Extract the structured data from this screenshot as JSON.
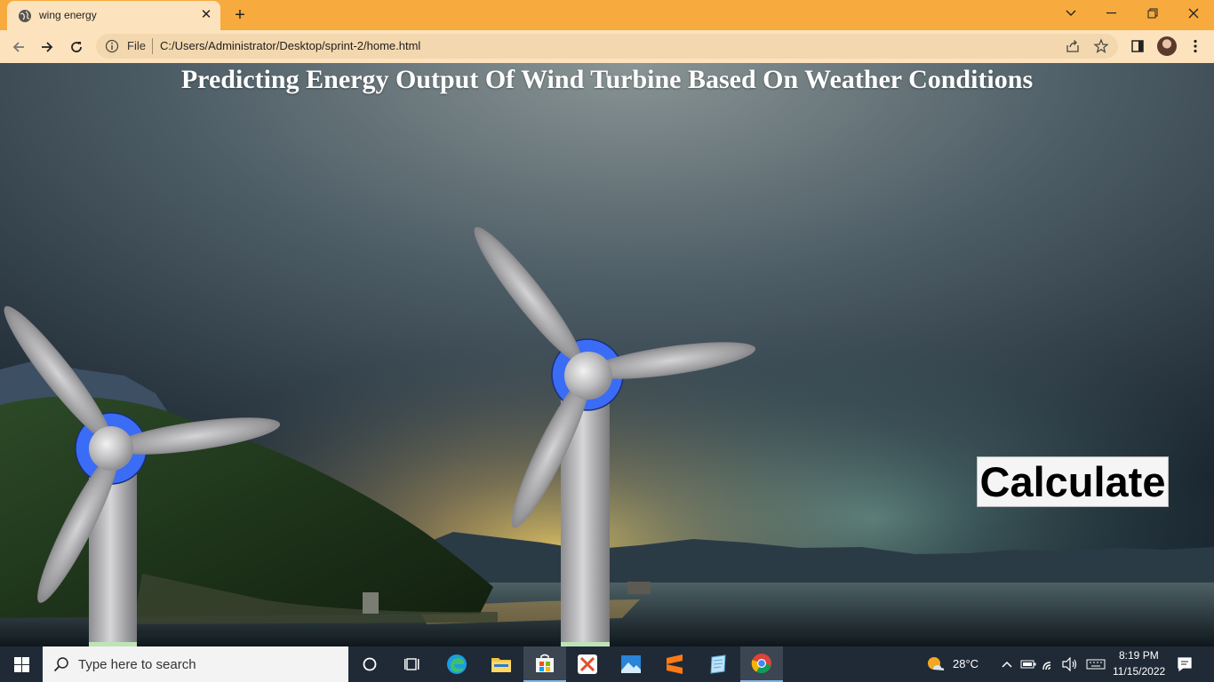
{
  "browser": {
    "tab_title": "wing energy",
    "file_label": "File",
    "url": "C:/Users/Administrator/Desktop/sprint-2/home.html"
  },
  "page": {
    "title": "Predicting Energy Output Of Wind Turbine Based On Weather Conditions",
    "calculate_label": "Calculate"
  },
  "taskbar": {
    "search_placeholder": "Type here to search",
    "weather_temp": "28°C",
    "time": "8:19 PM",
    "date": "11/15/2022"
  },
  "colors": {
    "titlebar": "#f7aa3d",
    "toolbar": "#fde3bd",
    "hub_blue": "#3b6cf5",
    "taskbar": "#1f2a36"
  },
  "icons": {
    "tab": [
      "globe-icon",
      "close-icon",
      "plus-icon"
    ],
    "window": [
      "chevron-down-icon",
      "minimize-icon",
      "restore-icon",
      "close-icon"
    ],
    "toolbar": [
      "back-arrow-icon",
      "forward-arrow-icon",
      "reload-icon",
      "info-icon",
      "share-icon",
      "star-icon",
      "side-panel-icon",
      "profile-avatar",
      "kebab-menu-icon"
    ],
    "taskbar": [
      "windows-start-icon",
      "search-icon",
      "cortana-icon",
      "task-view-icon",
      "edge-icon",
      "file-explorer-icon",
      "store-icon",
      "xampp-icon",
      "photos-icon",
      "sublime-icon",
      "notepad-icon",
      "chrome-icon",
      "weather-icon",
      "chevron-up-icon",
      "battery-icon",
      "wifi-icon",
      "speaker-icon",
      "keyboard-icon",
      "notification-icon"
    ]
  }
}
